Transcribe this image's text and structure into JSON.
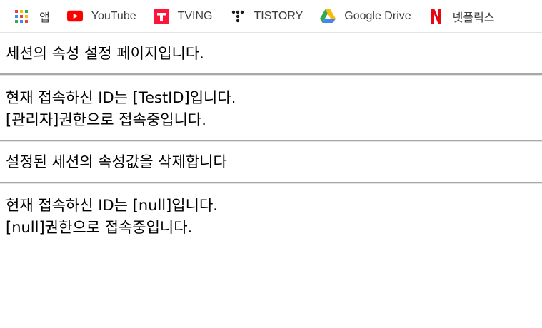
{
  "bookmarks": [
    {
      "label": "앱",
      "icon": "apps-grid-icon"
    },
    {
      "label": "YouTube",
      "icon": "youtube-icon",
      "color": "#ff0000"
    },
    {
      "label": "TVING",
      "icon": "tving-icon",
      "color": "#ff153c"
    },
    {
      "label": "TISTORY",
      "icon": "tistory-icon",
      "color": "#1a1a1a"
    },
    {
      "label": "Google Drive",
      "icon": "google-drive-icon"
    },
    {
      "label": "넷플릭스",
      "icon": "netflix-icon",
      "color": "#e50914"
    }
  ],
  "page": {
    "intro": "세션의 속성 설정 페이지입니다.",
    "first_id_line": "현재 접속하신 ID는 [TestID]입니다.",
    "first_role_line": "[관리자]권한으로 접속중입니다.",
    "delete_line": "설정된 세션의 속성값을 삭제합니다",
    "second_id_line": "현재 접속하신 ID는 [null]입니다.",
    "second_role_line": "[null]권한으로 접속중입니다."
  }
}
